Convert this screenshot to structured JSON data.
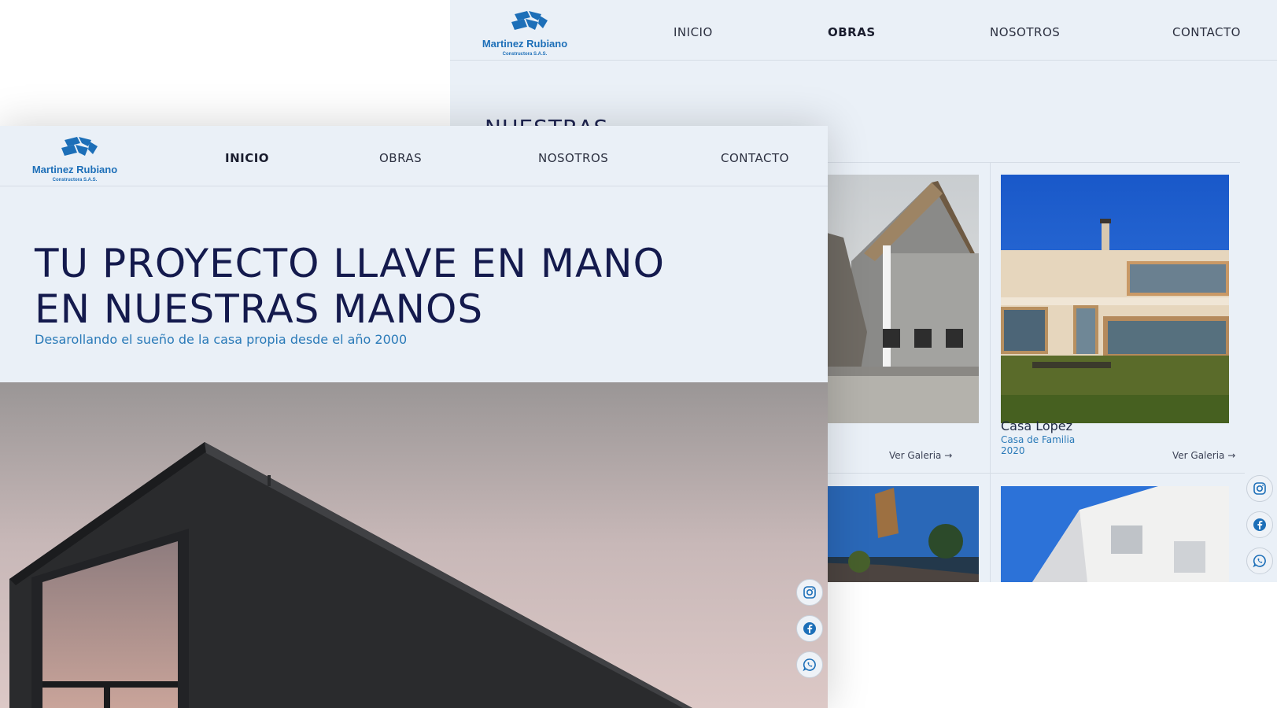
{
  "brand": {
    "name": "Martinez Rubiano",
    "tagline": "Constructora S.A.S.",
    "color": "#1d6fb8"
  },
  "back_page": {
    "nav": [
      "INICIO",
      "OBRAS",
      "NOSOTROS",
      "CONTACTO"
    ],
    "active_nav": "OBRAS",
    "section_title": "NUESTRAS",
    "cards": [
      {
        "link": "Ver Galeria"
      },
      {
        "name": "Casa Lopez",
        "type": "Casa de Familia",
        "year": "2020",
        "link": "Ver Galeria"
      }
    ],
    "social": [
      "instagram-icon",
      "facebook-icon",
      "whatsapp-icon"
    ]
  },
  "front_page": {
    "nav": [
      "INICIO",
      "OBRAS",
      "NOSOTROS",
      "CONTACTO"
    ],
    "active_nav": "INICIO",
    "hero_title_line1": "TU PROYECTO LLAVE EN MANO",
    "hero_title_line2": "EN NUESTRAS MANOS",
    "hero_subtitle": "Desarollando el sueño de la casa propia desde el año 2000",
    "social": [
      "instagram-icon",
      "facebook-icon",
      "whatsapp-icon"
    ]
  },
  "colors": {
    "page_bg": "#eaf0f7",
    "title": "#141a4d",
    "accent": "#2a7ab8"
  }
}
